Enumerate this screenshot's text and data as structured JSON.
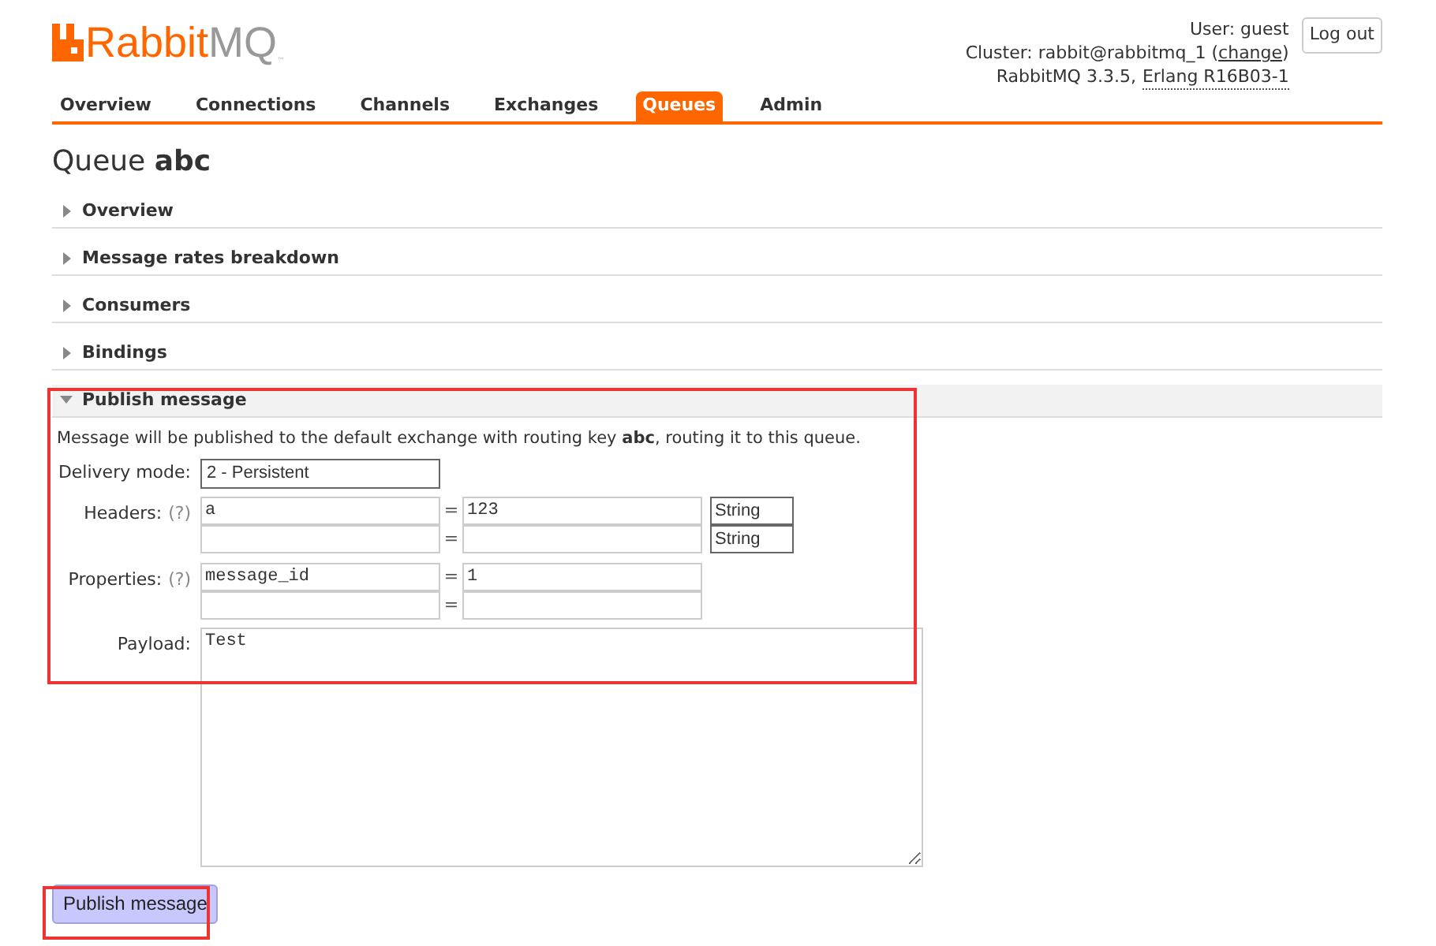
{
  "header": {
    "logo_main": "Rabbit",
    "logo_suffix": "MQ",
    "logo_tm": "™",
    "user_text": "User: guest",
    "cluster_text": "Cluster: rabbit@rabbitmq_1 (",
    "change_link": "change",
    "cluster_close": ")",
    "version_text": "RabbitMQ 3.3.5,",
    "erlang_link": "Erlang R16B03-1",
    "logout_button": "Log out"
  },
  "tabs": [
    {
      "label": "Overview",
      "selected": false
    },
    {
      "label": "Connections",
      "selected": false
    },
    {
      "label": "Channels",
      "selected": false
    },
    {
      "label": "Exchanges",
      "selected": false
    },
    {
      "label": "Queues",
      "selected": true
    },
    {
      "label": "Admin",
      "selected": false
    }
  ],
  "page_title": {
    "prefix": "Queue",
    "name": "abc"
  },
  "sections": [
    {
      "title": "Overview",
      "expanded": false
    },
    {
      "title": "Message rates breakdown",
      "expanded": false
    },
    {
      "title": "Consumers",
      "expanded": false
    },
    {
      "title": "Bindings",
      "expanded": false
    },
    {
      "title": "Publish message",
      "expanded": true
    }
  ],
  "publish": {
    "intro": "Message will be published to the default exchange with routing key **abc**, routing it to this queue.",
    "delivery_mode": {
      "label": "Delivery mode:",
      "value": "2 - Persistent"
    },
    "headers": {
      "label": "Headers:",
      "help": "(?)",
      "rows": [
        {
          "key": "a",
          "eq": "=",
          "value": "123",
          "type": "String"
        },
        {
          "eq": "=",
          "type": "String"
        }
      ]
    },
    "properties": {
      "label": "Properties:",
      "help": "(?)",
      "rows": [
        {
          "key": "message_id",
          "eq": "=",
          "value": "1"
        },
        {
          "eq": "="
        }
      ]
    },
    "payload": {
      "label": "Payload:",
      "value": "Test"
    },
    "submit_button": "Publish message"
  }
}
